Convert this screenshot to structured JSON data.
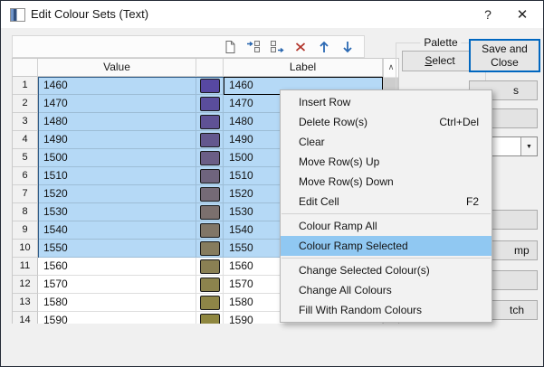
{
  "window": {
    "title": "Edit Colour Sets (Text)",
    "help_glyph": "?",
    "close_glyph": "✕"
  },
  "toolbar": {
    "icons": [
      "new-table",
      "insert-row-before",
      "insert-row-after",
      "delete-rows",
      "move-row-up",
      "move-row-down"
    ]
  },
  "table": {
    "columns": {
      "value": "Value",
      "label": "Label"
    },
    "scrollbar_up_glyph": "∧",
    "rows": [
      {
        "num": "1",
        "value": "1460",
        "label": "1460",
        "color": "#5748a2",
        "selected": true
      },
      {
        "num": "2",
        "value": "1470",
        "label": "1470",
        "color": "#5a4d9c",
        "selected": true
      },
      {
        "num": "3",
        "value": "1480",
        "label": "1480",
        "color": "#5f5295",
        "selected": true
      },
      {
        "num": "4",
        "value": "1490",
        "label": "1490",
        "color": "#64588e",
        "selected": true
      },
      {
        "num": "5",
        "value": "1500",
        "label": "1500",
        "color": "#6a5e86",
        "selected": true
      },
      {
        "num": "6",
        "value": "1510",
        "label": "1510",
        "color": "#6f647e",
        "selected": true
      },
      {
        "num": "7",
        "value": "1520",
        "label": "1520",
        "color": "#756a76",
        "selected": true
      },
      {
        "num": "8",
        "value": "1530",
        "label": "1530",
        "color": "#7b706e",
        "selected": true
      },
      {
        "num": "9",
        "value": "1540",
        "label": "1540",
        "color": "#817667",
        "selected": true
      },
      {
        "num": "10",
        "value": "1550",
        "label": "1550",
        "color": "#867c5e",
        "selected": true
      },
      {
        "num": "11",
        "value": "1560",
        "label": "1560",
        "color": "#8a8053",
        "selected": false
      },
      {
        "num": "12",
        "value": "1570",
        "label": "1570",
        "color": "#8c834d",
        "selected": false
      },
      {
        "num": "13",
        "value": "1580",
        "label": "1580",
        "color": "#8e8547",
        "selected": false
      },
      {
        "num": "14",
        "value": "1590",
        "label": "1590",
        "color": "#8f8740",
        "selected": false
      }
    ]
  },
  "palette": {
    "title": "Palette",
    "select_button_accel": "S",
    "select_button_rest": "elect"
  },
  "save_close_button": "Save and Close",
  "right_panel": {
    "combo_arrow_glyph": "▼",
    "fragments": [
      {
        "text": "s"
      },
      {
        "text": ""
      },
      {
        "text": "",
        "combo": true
      },
      {
        "text": ""
      },
      {
        "text": "mp"
      },
      {
        "text": ""
      },
      {
        "text": "tch"
      }
    ]
  },
  "context_menu": {
    "items": [
      {
        "label": "Insert Row"
      },
      {
        "label": "Delete Row(s)",
        "shortcut": "Ctrl+Del"
      },
      {
        "label": "Clear"
      },
      {
        "label": "Move Row(s) Up"
      },
      {
        "label": "Move Row(s) Down"
      },
      {
        "label": "Edit Cell",
        "shortcut": "F2"
      },
      {
        "separator": true
      },
      {
        "label": "Colour Ramp All"
      },
      {
        "label": "Colour Ramp Selected",
        "highlighted": true
      },
      {
        "separator": true
      },
      {
        "label": "Change Selected Colour(s)"
      },
      {
        "label": "Change All Colours"
      },
      {
        "label": "Fill With Random Colours"
      }
    ]
  },
  "colors": {
    "selection_fill": "#b5d9f6",
    "selection_outline": "#2e5a86",
    "menu_highlight": "#90c8f2",
    "focus_button_border": "#0067c0"
  }
}
